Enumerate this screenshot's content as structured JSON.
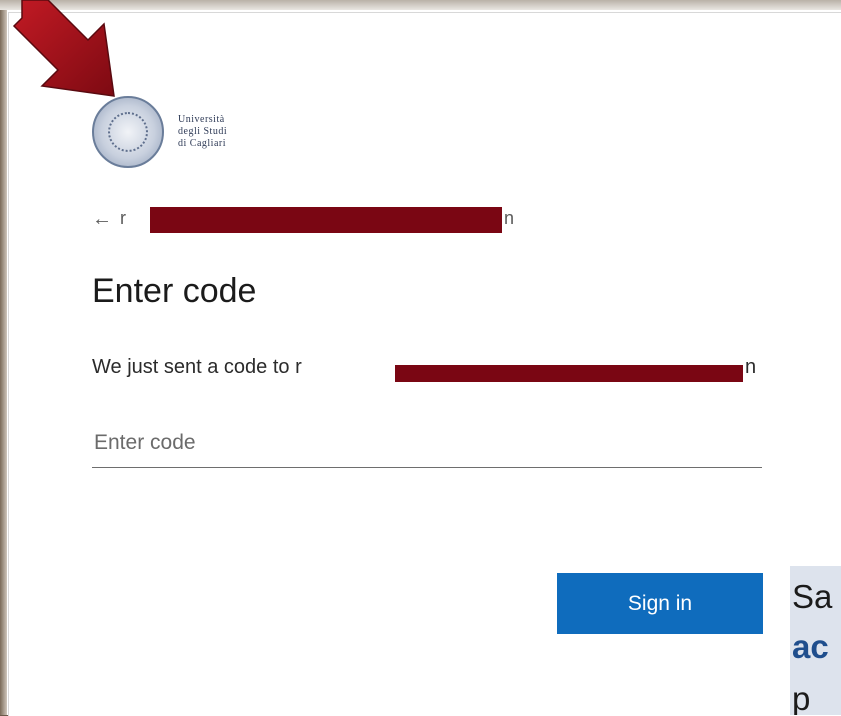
{
  "logo": {
    "lines": [
      "Università",
      "degli Studi",
      "di Cagliari"
    ]
  },
  "account": {
    "back_icon": "←",
    "visible_start": "r",
    "visible_end": "n"
  },
  "page": {
    "title": "Enter code",
    "description_prefix": "We just sent a code to r",
    "description_suffix": "n"
  },
  "input": {
    "placeholder": "Enter code",
    "value": ""
  },
  "actions": {
    "sign_in_label": "Sign in"
  },
  "side_panel": {
    "line1": "Sa",
    "line2": "ac",
    "line3": "p"
  },
  "colors": {
    "accent": "#0f6cbd",
    "redaction": "#7a0613",
    "pointer_arrow": "#9a0f19"
  },
  "icons": {
    "back": "back-arrow-icon",
    "pointer": "pointer-arrow-icon"
  }
}
